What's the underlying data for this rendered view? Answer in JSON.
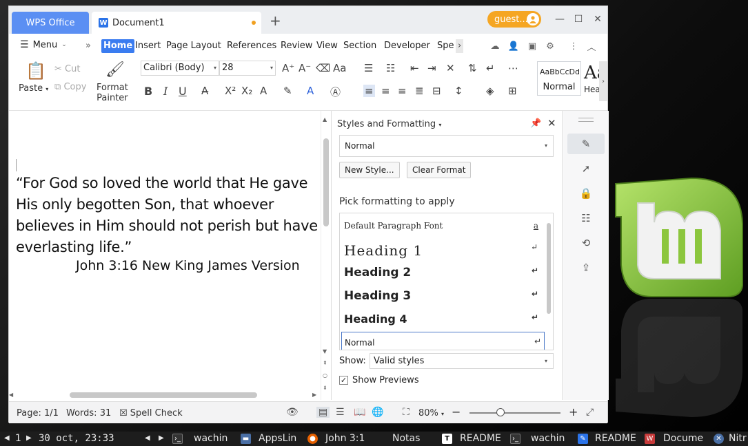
{
  "window": {
    "app_tab": "WPS Office",
    "doc_tab": "Document1",
    "doc_icon_letter": "W",
    "new_tab": "+",
    "user": "guest...",
    "controls": {
      "minimize": "—",
      "maximize": "☐",
      "close": "✕"
    }
  },
  "menu": {
    "menu_label": "Menu",
    "more": "»",
    "tabs": [
      "Home",
      "Insert",
      "Page Layout",
      "References",
      "Review",
      "View",
      "Section",
      "Developer",
      "Spe"
    ],
    "active_tab": "Home",
    "scroll_right": "›"
  },
  "ribbon": {
    "paste": "Paste",
    "cut": "Cut",
    "copy": "Copy",
    "format_painter_line1": "Format",
    "format_painter_line2": "Painter",
    "font_name": "Calibri (Body)",
    "font_size": "28",
    "bold": "B",
    "italic": "I",
    "underline": "U",
    "superscript": "X²",
    "subscript": "X₂",
    "styles": [
      {
        "sample": "AaBbCcDd",
        "label": "Normal"
      },
      {
        "sample": "Aa",
        "label": "Hea"
      }
    ]
  },
  "document": {
    "verse": "“For God so loved the world that He gave His only begotten Son, that whoever believes in Him should not perish but have everlasting life.”",
    "reference": "John 3:16 New King James Version"
  },
  "styles_panel": {
    "title": "Styles and Formatting",
    "current_style": "Normal",
    "new_style_button": "New Style...",
    "clear_format_button": "Clear Format",
    "pick_label": "Pick formatting to apply",
    "items": [
      {
        "name": "Default Paragraph Font",
        "mark": "a"
      },
      {
        "name": "Heading 1",
        "mark": "↵"
      },
      {
        "name": "Heading 2",
        "mark": "↵"
      },
      {
        "name": "Heading 3",
        "mark": "↵"
      },
      {
        "name": "Heading 4",
        "mark": "↵"
      },
      {
        "name": "Normal",
        "mark": "↵"
      }
    ],
    "show_label": "Show:",
    "show_value": "Valid styles",
    "show_previews_label": "Show Previews",
    "show_previews_checked": true
  },
  "statusbar": {
    "page": "Page: 1/1",
    "words": "Words: 31",
    "spell_check": "Spell Check",
    "zoom": "80%",
    "zoom_level": 0.34
  },
  "taskbar": {
    "workspace": "1",
    "clock": "30 oct, 23:33",
    "items": [
      "wachin",
      "AppsLin",
      "John 3:1",
      "Notas",
      "README",
      "wachin",
      "README",
      "Docume",
      "Nitr"
    ]
  },
  "colors": {
    "accent": "#3a7cf0",
    "wps_tab": "#5b8ff3",
    "guest_badge": "#f5a623",
    "mint_green": "#8cc63e"
  }
}
